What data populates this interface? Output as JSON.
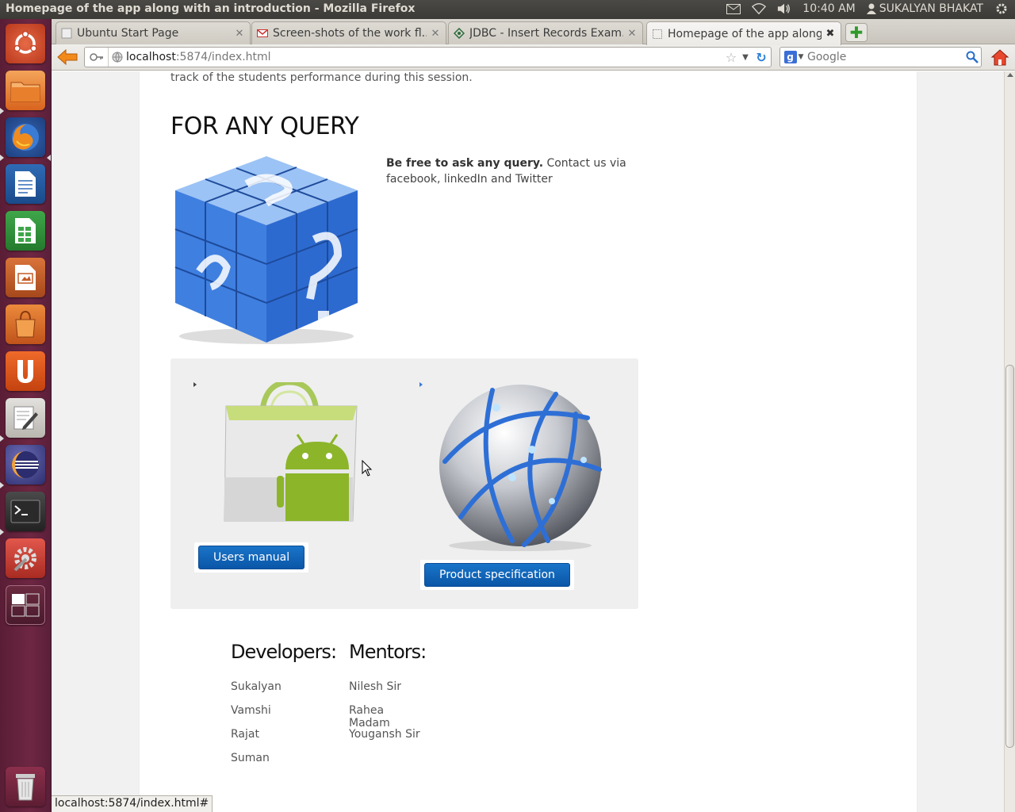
{
  "window": {
    "title": "Homepage of the app along with an introduction - Mozilla Firefox"
  },
  "panel": {
    "clock": "10:40 AM",
    "user": "SUKALYAN BHAKAT"
  },
  "tabs": [
    {
      "label": "Ubuntu Start Page",
      "active": false
    },
    {
      "label": "Screen-shots of the work fl...",
      "active": false
    },
    {
      "label": "JDBC - Insert Records Exam...",
      "active": false
    },
    {
      "label": "Homepage of the app along...",
      "active": true
    }
  ],
  "navbar": {
    "url_host": "localhost",
    "url_rest": ":5874/index.html",
    "search_placeholder": "Google"
  },
  "page": {
    "intro_tail": "track of the students performance during this session.",
    "query_heading": "FOR ANY QUERY",
    "query_bold": "Be free to ask any query.",
    "query_text": " Contact us via facebook, linkedIn and Twitter",
    "users_manual_button": "Users manual",
    "product_spec_button": "Product specification",
    "developers_heading": "Developers:",
    "developers": [
      "Sukalyan",
      "Vamshi",
      "Rajat",
      "Suman"
    ],
    "mentors_heading": "Mentors:",
    "mentors": [
      "Nilesh Sir",
      "Rahea Madam",
      "Yougansh Sir"
    ]
  },
  "statusbar": {
    "text": "localhost:5874/index.html#"
  },
  "colors": {
    "launcher": "#6e2742",
    "button_blue": "#0a56a8",
    "panel_bg": "#efefef"
  },
  "icons": {
    "launcher": [
      "ubuntu-dash-icon",
      "files-icon",
      "firefox-icon",
      "writer-icon",
      "calc-icon",
      "impress-icon",
      "software-center-icon",
      "ubuntu-one-icon",
      "gedit-icon",
      "eclipse-icon",
      "terminal-icon",
      "system-settings-icon",
      "workspace-switcher-icon",
      "trash-icon"
    ]
  }
}
